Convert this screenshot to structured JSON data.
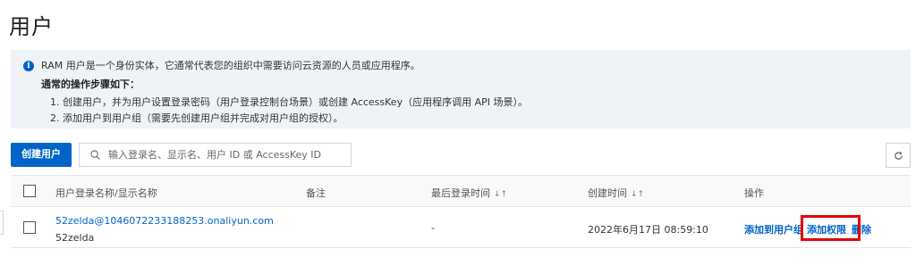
{
  "page": {
    "title": "用户"
  },
  "info": {
    "icon": "info-icon",
    "description": "RAM 用户是一个身份实体，它通常代表您的组织中需要访问云资源的人员或应用程序。",
    "heading": "通常的操作步骤如下：",
    "steps": [
      "1. 创建用户，并为用户设置登录密码（用户登录控制台场景）或创建 AccessKey（应用程序调用 API 场景）。",
      "2. 添加用户到用户组（需要先创建用户组并完成对用户组的授权）。"
    ]
  },
  "toolbar": {
    "create_label": "创建用户",
    "search_placeholder": "输入登录名、显示名、用户 ID 或 AccessKey ID",
    "search_value": ""
  },
  "table": {
    "columns": [
      "用户登录名称/显示名称",
      "备注",
      "最后登录时间",
      "创建时间",
      "操作"
    ],
    "sort_icon": "↓↑",
    "rows": [
      {
        "login_name": "52zelda@1046072233188253.onaliyun.com",
        "display_name": "52zelda",
        "note": "-",
        "last_login": "",
        "created": "2022年6月17日 08:59:10",
        "actions": [
          "添加到用户组",
          "添加权限",
          "删除"
        ]
      }
    ]
  },
  "colors": {
    "accent": "#0064c8",
    "info_bg": "#eff3f8",
    "highlight": "#e60000"
  }
}
